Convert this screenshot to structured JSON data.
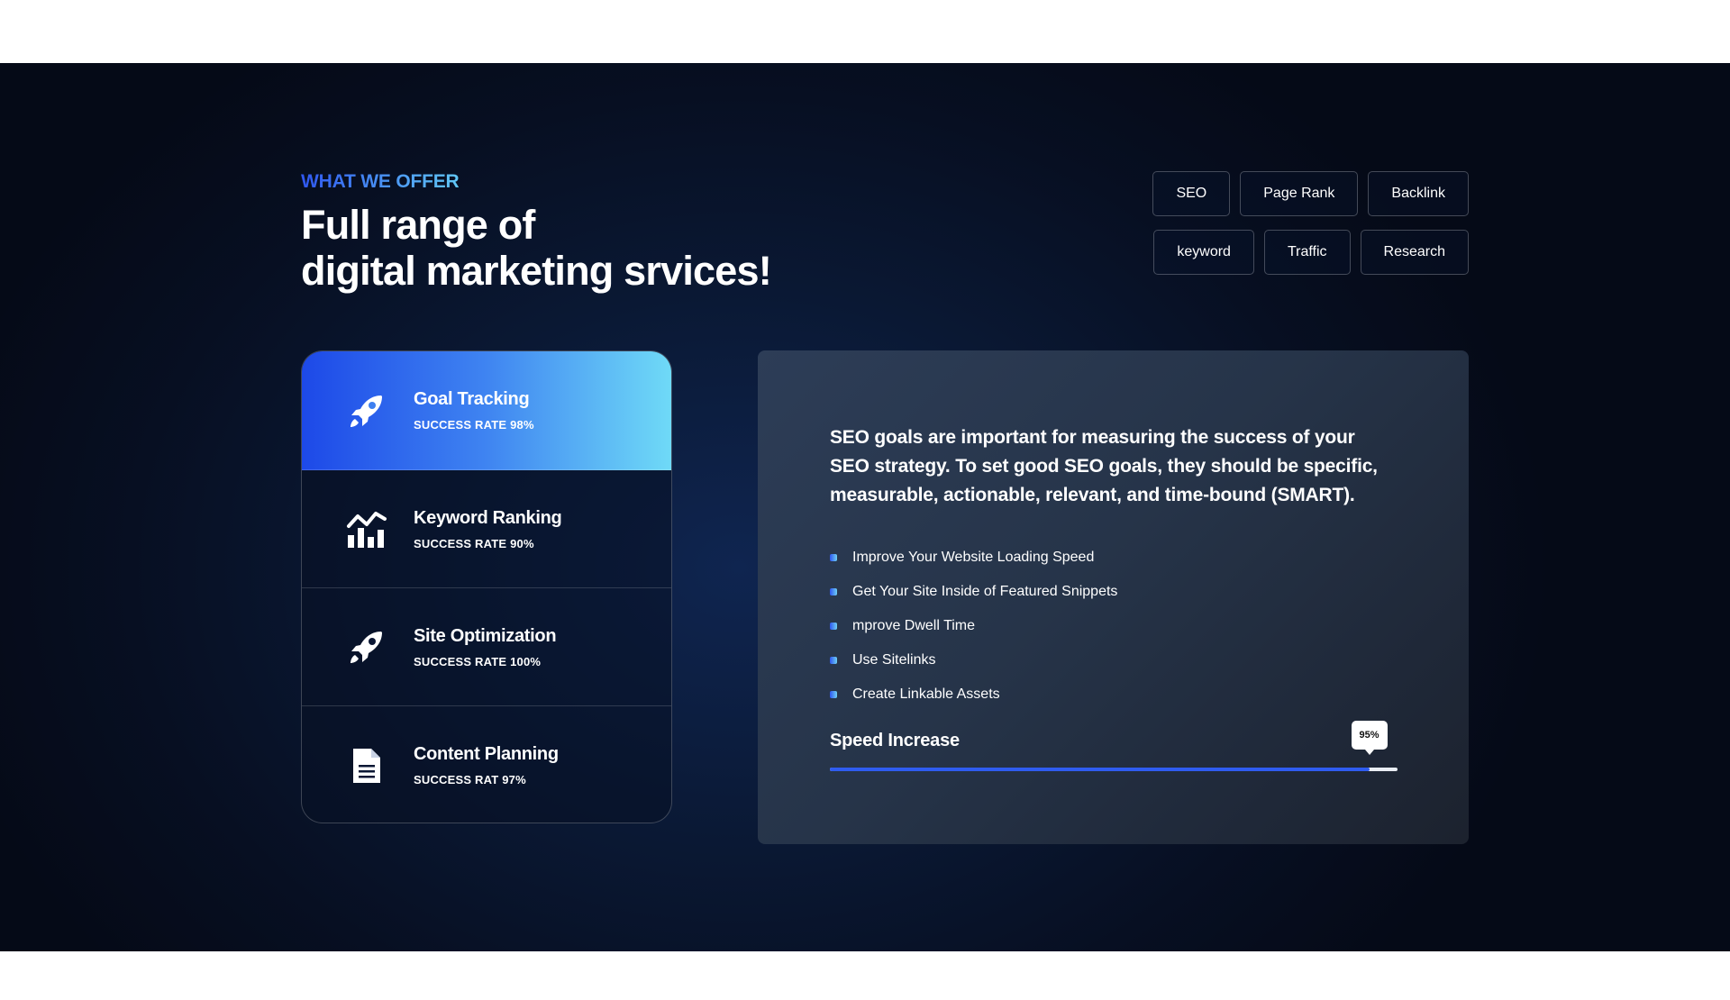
{
  "header": {
    "eyebrow": "WHAT WE OFFER",
    "title_line1": "Full range of",
    "title_line2": "digital marketing srvices!"
  },
  "tags": {
    "row1": [
      "SEO",
      "Page Rank",
      "Backlink"
    ],
    "row2": [
      "keyword",
      "Traffic",
      "Research"
    ]
  },
  "services": [
    {
      "title": "Goal Tracking",
      "rate": "SUCCESS RATE 98%",
      "icon": "rocket-icon"
    },
    {
      "title": "Keyword Ranking",
      "rate": "SUCCESS RATE 90%",
      "icon": "bar-chart-icon"
    },
    {
      "title": "Site Optimization",
      "rate": "SUCCESS RATE 100%",
      "icon": "rocket-icon"
    },
    {
      "title": "Content Planning",
      "rate": "SUCCESS RAT 97%",
      "icon": "document-icon"
    }
  ],
  "panel": {
    "description": "SEO goals are important for measuring the success of your SEO strategy. To set good SEO goals, they should be specific, measurable, actionable, relevant, and time-bound (SMART).",
    "items": [
      "Improve Your Website Loading Speed",
      "Get Your Site Inside of Featured Snippets",
      "mprove Dwell Time",
      "Use Sitelinks",
      "Create Linkable Assets"
    ],
    "progress": {
      "label": "Speed Increase",
      "percent_label": "95%",
      "value": 95
    }
  },
  "colors": {
    "accent_start": "#1d49e8",
    "accent_end": "#6fdaf7",
    "progress": "#2f5cf0"
  }
}
